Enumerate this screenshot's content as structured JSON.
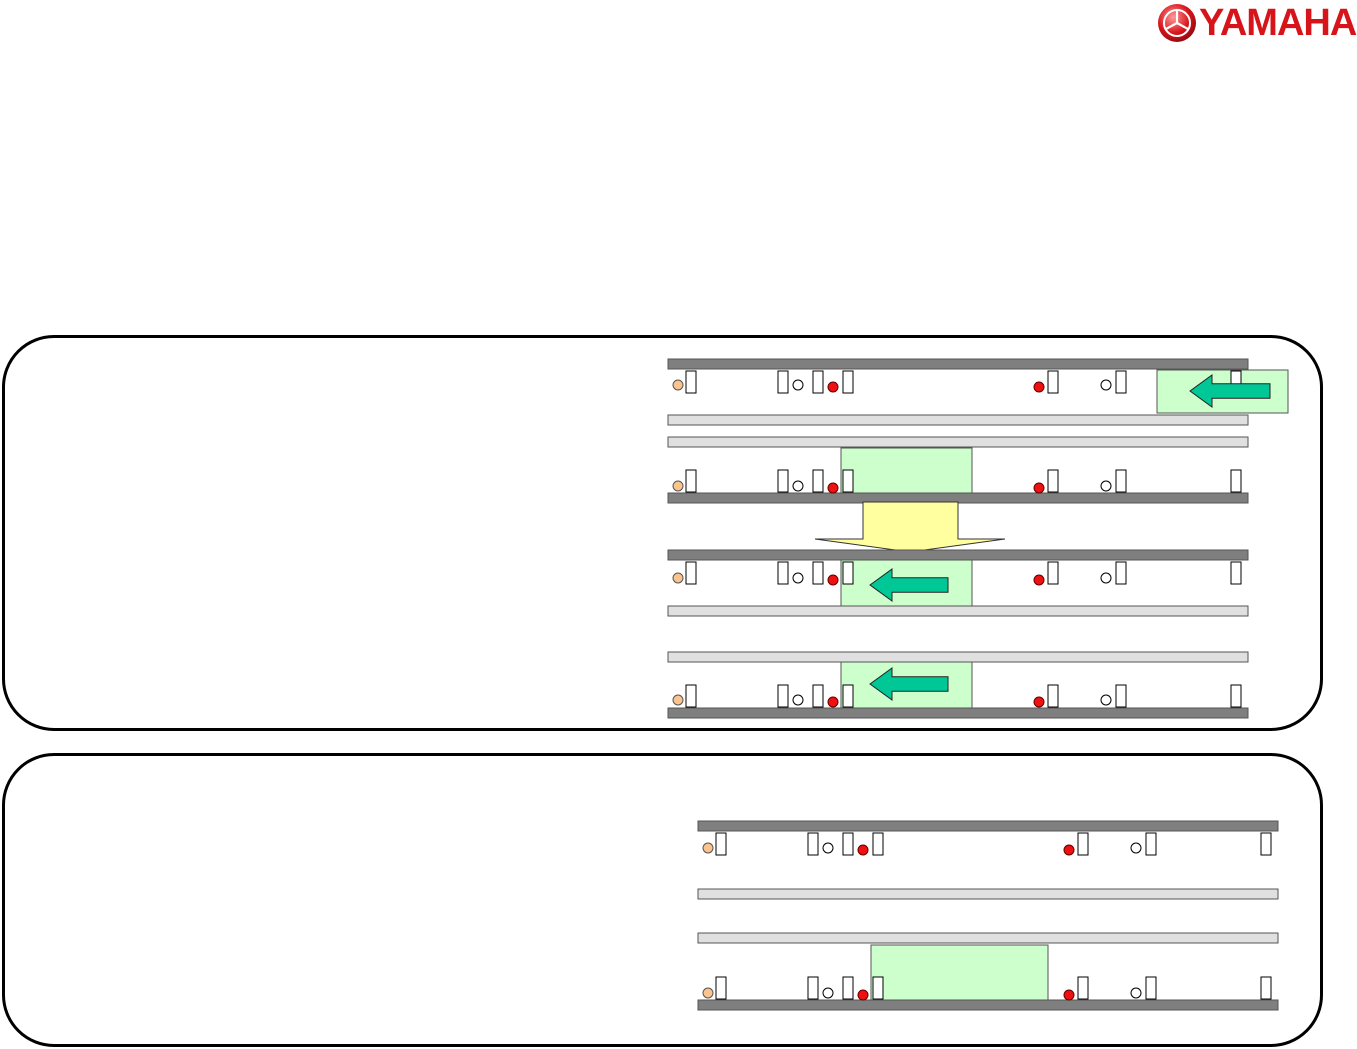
{
  "header": {
    "logo_text": "YAMAHA",
    "logo_icon": "yamaha-tuning-fork-emblem-icon"
  },
  "colors": {
    "rail_dark": "#7f7f7f",
    "rail_light": "#e0e0e0",
    "highlight_green": "#ccffcc",
    "arrow_teal": "#00c796",
    "arrow_yellow": "#ffffa0",
    "dot_orange": "#fbc38e",
    "dot_red": "#ee1111",
    "dot_white": "#ffffff"
  },
  "panels": [
    {
      "name": "upper-sequence",
      "tracks": [
        {
          "style": "dark-top",
          "highlight": "right-edge",
          "arrow": "left"
        },
        {
          "style": "dark-bottom",
          "highlight": "middle",
          "arrow": "none"
        },
        {
          "style": "dark-top",
          "highlight": "middle",
          "arrow": "left"
        },
        {
          "style": "dark-bottom",
          "highlight": "middle",
          "arrow": "left"
        }
      ],
      "transition_arrow": "down"
    },
    {
      "name": "lower-sequence",
      "tracks": [
        {
          "style": "dark-top",
          "highlight": "none",
          "arrow": "none"
        },
        {
          "style": "dark-bottom",
          "highlight": "middle-wide",
          "arrow": "none"
        }
      ]
    }
  ]
}
